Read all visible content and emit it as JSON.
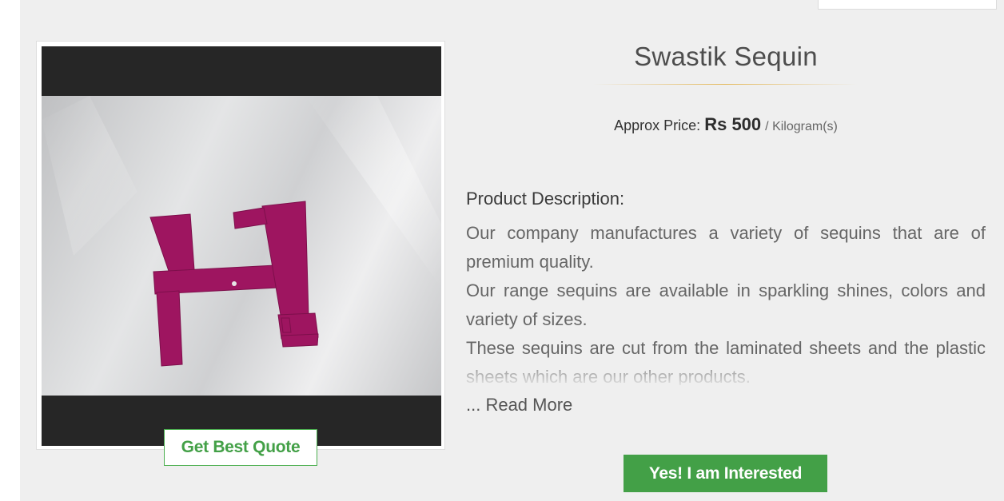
{
  "product": {
    "title": "Swastik Sequin",
    "price_label": "Approx Price:",
    "price_value": "Rs 500",
    "price_unit": "/ Kilogram(s)",
    "image_name": "swastik-sequin-photo"
  },
  "description": {
    "heading": "Product Description:",
    "paragraphs": [
      "Our company manufactures a variety of sequins that are of premium quality.",
      "Our range sequins are available in sparkling shines, colors and variety of sizes.",
      "These sequins are cut from the laminated sheets and the plastic sheets which are our other products."
    ],
    "read_more": "... Read More"
  },
  "actions": {
    "quote_label": "Get Best Quote",
    "interested_label": "Yes! I am Interested"
  },
  "colors": {
    "accent_green": "#43a047",
    "sequin_magenta": "#a3155f",
    "divider_gold": "#e3b757"
  }
}
